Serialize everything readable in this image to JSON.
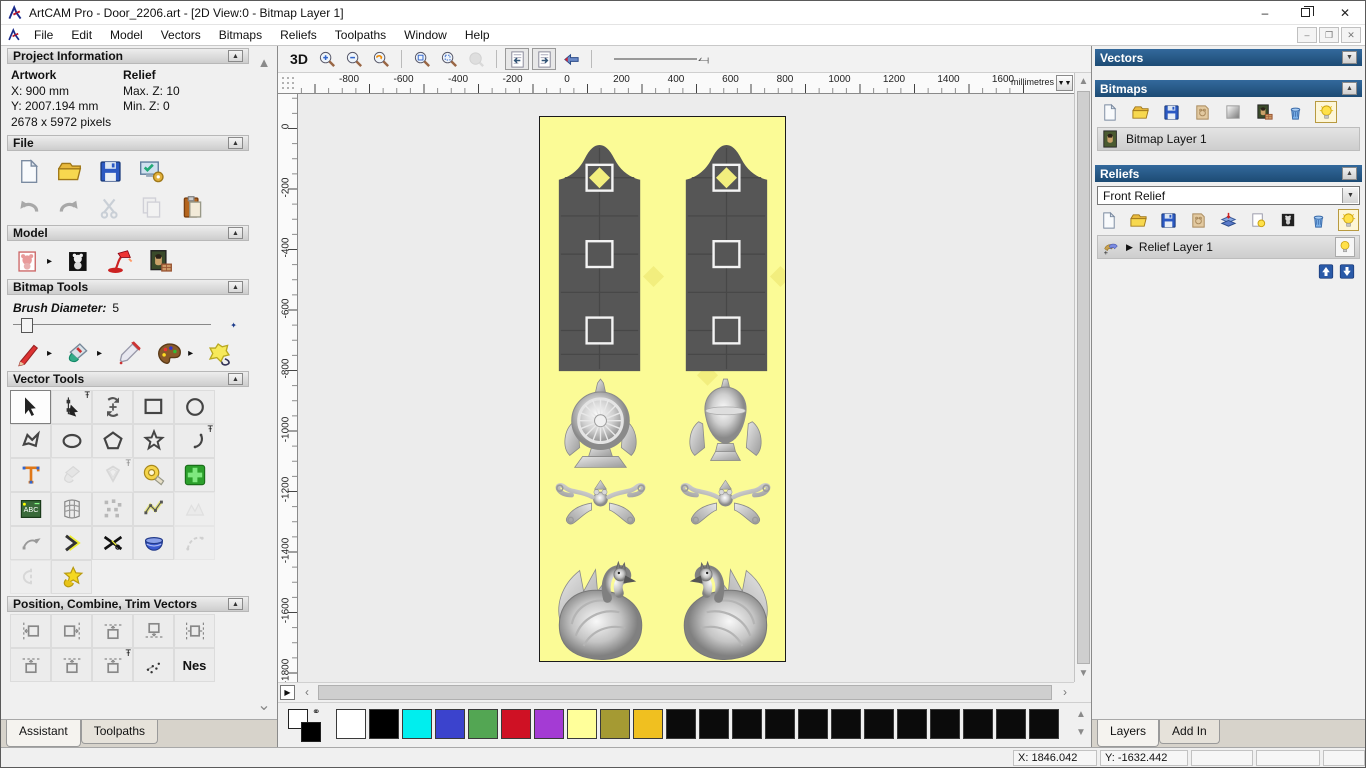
{
  "titlebar": {
    "title": "ArtCAM Pro - Door_2206.art - [2D View:0 - Bitmap Layer 1]"
  },
  "menu": {
    "items": [
      "File",
      "Edit",
      "Model",
      "Vectors",
      "Bitmaps",
      "Reliefs",
      "Toolpaths",
      "Window",
      "Help"
    ]
  },
  "assistant": {
    "sections": {
      "project_information": "Project Information",
      "file": "File",
      "model": "Model",
      "bitmap_tools": "Bitmap Tools",
      "vector_tools": "Vector Tools",
      "position_combine": "Position, Combine, Trim Vectors"
    },
    "project_info": {
      "artwork_label": "Artwork",
      "x": "X: 900 mm",
      "y": "Y: 2007.194 mm",
      "pixels": "2678 x 5972 pixels",
      "relief_label": "Relief",
      "max_z": "Max. Z: 10",
      "min_z": "Min. Z: 0"
    },
    "brush_diameter_label": "Brush Diameter:",
    "brush_diameter_value": "5",
    "file_tools_row1": [
      {
        "icon": "new-page",
        "name": "new-model-button"
      },
      {
        "icon": "folder",
        "name": "open-model-button"
      },
      {
        "icon": "floppy",
        "name": "save-model-button"
      },
      {
        "icon": "model-wizard",
        "name": "model-wizard-button"
      }
    ],
    "file_tools_row2": [
      {
        "icon": "undo",
        "name": "undo-button"
      },
      {
        "icon": "redo",
        "name": "redo-button"
      },
      {
        "icon": "scissors",
        "name": "cut-button",
        "disabled": true
      },
      {
        "icon": "copy",
        "name": "copy-button",
        "disabled": true
      },
      {
        "icon": "paste",
        "name": "paste-button"
      }
    ],
    "model_tools": [
      {
        "icon": "bear-page",
        "name": "set-model-size-button",
        "fly": true
      },
      {
        "icon": "bear-invert",
        "name": "invert-model-button"
      },
      {
        "icon": "lamp",
        "name": "lighting-button"
      },
      {
        "icon": "mona",
        "name": "texture-relief-button"
      }
    ],
    "bitmap_tools_icons": [
      {
        "icon": "pencil",
        "name": "paint-tool",
        "fly": true
      },
      {
        "icon": "bucket",
        "name": "flood-fill-tool",
        "fly": true
      },
      {
        "icon": "pipette",
        "name": "pick-colour-tool"
      },
      {
        "icon": "palette-icon",
        "name": "edit-palette-tool",
        "fly": true
      },
      {
        "icon": "blob-lasso",
        "name": "bitmap-to-vector-tool"
      }
    ],
    "vector_tools_grid": [
      [
        {
          "icon": "select-arrow",
          "name": "select-vectors-tool",
          "active": true
        },
        {
          "icon": "node-edit",
          "name": "node-editing-tool",
          "pin": true
        },
        {
          "icon": "transform",
          "name": "transform-vectors-tool"
        },
        {
          "icon": "rect-tool",
          "name": "create-rectangle-tool"
        },
        {
          "icon": "circle-tool",
          "name": "create-circle-tool"
        }
      ],
      [
        {
          "icon": "polyline-tool",
          "name": "create-polyline-tool"
        },
        {
          "icon": "ellipse-tool",
          "name": "create-ellipse-tool"
        },
        {
          "icon": "polygon-tool",
          "name": "create-polygon-tool"
        },
        {
          "icon": "star-tool",
          "name": "create-star-tool"
        },
        {
          "icon": "arc-tool",
          "name": "create-arc-tool",
          "pin": true
        }
      ],
      [
        {
          "icon": "text-tool",
          "name": "create-text-tool"
        },
        {
          "icon": "pour-faded",
          "name": "vector-pour-tool",
          "disabled": true
        },
        {
          "icon": "offset-faded",
          "name": "offset-vector-tool",
          "disabled": true,
          "pin": true
        },
        {
          "icon": "measure",
          "name": "measure-tool"
        },
        {
          "icon": "green-cross",
          "name": "paste-weld-tool"
        }
      ],
      [
        {
          "icon": "abc-block",
          "name": "text-block-tool"
        },
        {
          "icon": "distort-grid",
          "name": "envelope-distort-tool"
        },
        {
          "icon": "dots-pattern",
          "name": "block-paste-tool"
        },
        {
          "icon": "fit-nodes",
          "name": "fit-polyline-tool"
        },
        {
          "icon": "mountains-faded",
          "name": "simplify-vectors-tool",
          "disabled": true
        }
      ],
      [
        {
          "icon": "stretch-curve",
          "name": "stretch-curve-tool"
        },
        {
          "icon": "chevron",
          "name": "sharpen-corner-tool"
        },
        {
          "icon": "cut-x",
          "name": "trim-vectors-tool"
        },
        {
          "icon": "bowl",
          "name": "extrude-vector-tool"
        },
        {
          "icon": "dashed-curve",
          "name": "join-vectors-tool",
          "disabled": true
        }
      ],
      [
        {
          "icon": "mirror-half",
          "name": "mirror-vectors-tool",
          "disabled": true
        },
        {
          "icon": "doctor-star",
          "name": "vector-doctor-tool"
        }
      ]
    ],
    "position_tools_row1": [
      {
        "icon": "align-left",
        "name": "align-left-button"
      },
      {
        "icon": "align-right",
        "name": "align-right-button"
      },
      {
        "icon": "align-top",
        "name": "align-top-button"
      },
      {
        "icon": "align-bottom",
        "name": "align-bottom-button"
      },
      {
        "icon": "center-page",
        "name": "center-in-page-button"
      }
    ],
    "position_tools_row2": [
      {
        "icon": "align-top",
        "name": "align-centre-vertical-button"
      },
      {
        "icon": "align-top",
        "name": "align-centre-horizontal-button"
      },
      {
        "icon": "align-top",
        "name": "stack-vectors-button",
        "pin": true
      },
      {
        "icon": "scatter-dots",
        "name": "scatter-copies-button"
      },
      {
        "text": "Nes",
        "name": "nesting-button"
      }
    ],
    "tabs": [
      {
        "label": "Assistant",
        "active": true
      },
      {
        "label": "Toolpaths",
        "active": false
      }
    ]
  },
  "canvas_toolbar": {
    "view_3d_label": "3D",
    "zoom_tools": [
      {
        "icon": "zoom-in",
        "name": "zoom-in-button"
      },
      {
        "icon": "zoom-out",
        "name": "zoom-out-button"
      },
      {
        "icon": "zoom-prev",
        "name": "zoom-previous-button"
      }
    ],
    "fit_tools": [
      {
        "icon": "zoom-fit",
        "name": "zoom-fit-button"
      },
      {
        "icon": "zoom-obj",
        "name": "zoom-objects-button"
      },
      {
        "icon": "zoom-gray",
        "name": "zoom-selected-button",
        "disabled": true
      }
    ],
    "view_toggles": [
      {
        "icon": "page-prev",
        "name": "previous-bitmap-toggle",
        "framed": true
      },
      {
        "icon": "page-next",
        "name": "next-bitmap-toggle",
        "framed": true
      },
      {
        "icon": "nudge",
        "name": "pointer-nudge-button"
      }
    ]
  },
  "ruler": {
    "h_labels": [
      -800,
      -600,
      -400,
      -200,
      0,
      200,
      400,
      600,
      800,
      1000,
      1200,
      1400,
      1600
    ],
    "v_labels": [
      0,
      -200,
      -400,
      -600,
      -800,
      -1000,
      -1200,
      -1400,
      -1600,
      -1800
    ],
    "units": "millimetres"
  },
  "palette": {
    "colors": [
      "#ffffff",
      "#000000",
      "#00eeee",
      "#3b43cd",
      "#53a653",
      "#cf1124",
      "#a43bd4",
      "#ffff9a",
      "#a59a33",
      "#f0c020",
      "#0b0b0b",
      "#0b0b0b",
      "#0b0b0b",
      "#0b0b0b",
      "#0b0b0b",
      "#0b0b0b",
      "#0b0b0b",
      "#0b0b0b",
      "#0b0b0b",
      "#0b0b0b",
      "#0b0b0b",
      "#0b0b0b"
    ]
  },
  "right_panel": {
    "vectors_title": "Vectors",
    "bitmaps_title": "Bitmaps",
    "reliefs_title": "Reliefs",
    "bitmap_layer_label": "Bitmap Layer 1",
    "relief_combo_value": "Front Relief",
    "relief_layer_label": "Relief Layer 1",
    "bitmap_toolbar": [
      {
        "icon": "new-page",
        "name": "new-bitmap-button"
      },
      {
        "icon": "folder",
        "name": "open-bitmap-button"
      },
      {
        "icon": "floppy",
        "name": "save-bitmap-button"
      },
      {
        "icon": "merge-bear",
        "name": "merge-bitmap-button"
      },
      {
        "icon": "gradient-sq",
        "name": "fade-bitmap-button"
      },
      {
        "icon": "mona",
        "name": "bitmap-properties-button"
      },
      {
        "icon": "trash",
        "name": "delete-bitmap-button"
      },
      {
        "icon": "bulb",
        "name": "toggle-bitmap-visibility-button",
        "framed": true
      }
    ],
    "relief_toolbar": [
      {
        "icon": "new-page",
        "name": "new-relief-button"
      },
      {
        "icon": "folder",
        "name": "open-relief-button"
      },
      {
        "icon": "floppy",
        "name": "save-relief-button"
      },
      {
        "icon": "merge-bear",
        "name": "merge-relief-button"
      },
      {
        "icon": "stack",
        "name": "combine-relief-button"
      },
      {
        "icon": "bulb-page",
        "name": "relief-preview-button"
      },
      {
        "icon": "bear-bw",
        "name": "greyscale-relief-button"
      },
      {
        "icon": "trash",
        "name": "delete-relief-button"
      },
      {
        "icon": "bulb",
        "name": "toggle-relief-visibility-button",
        "framed": true
      }
    ],
    "tabs": [
      {
        "label": "Layers",
        "active": true
      },
      {
        "label": "Add In",
        "active": false
      }
    ]
  },
  "statusbar": {
    "x": "X: 1846.042",
    "y": "Y: -1632.442"
  },
  "colors": {
    "header_blue": "#1d4b74",
    "canvas_yellow": "#fbfb96",
    "door_gray": "#565656",
    "inset_yellow": "#f2ee7e"
  }
}
